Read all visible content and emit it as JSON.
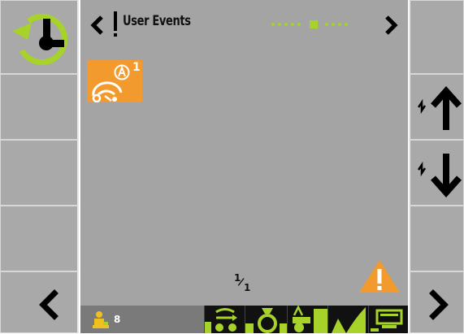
{
  "header": {
    "title": "User Events"
  },
  "pagination": {
    "current": "1",
    "total": "1"
  },
  "alert_tile": {
    "superscript": "1"
  },
  "footer": {
    "user_count": "8"
  },
  "colors": {
    "accent_green": "#a6d22a",
    "alert_orange": "#f39a2e",
    "panel_gray": "#a4a4a4"
  },
  "icons": {
    "home": "reset-clock-icon",
    "scroll_up": "arrow-up-icon",
    "scroll_down": "arrow-down-icon"
  }
}
